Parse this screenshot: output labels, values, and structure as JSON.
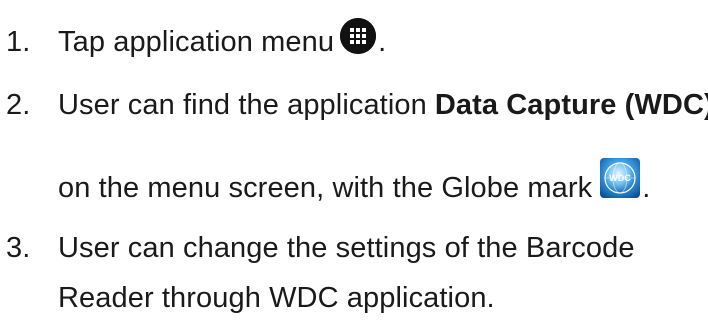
{
  "steps": [
    {
      "number": "1.",
      "text": "Tap application menu",
      "end": "."
    },
    {
      "number": "2.",
      "text": "User can find the application",
      "bold": "Data Capture (WDC)",
      "continuation": "on the menu screen, with the Globe mark",
      "end": "."
    },
    {
      "number": "3.",
      "text": "User can change the settings of the Barcode",
      "continuation": "Reader through WDC application."
    }
  ],
  "icons": {
    "menu": "app-grid-icon",
    "globe": "wdc-globe-icon",
    "globe_label": "WDC"
  }
}
